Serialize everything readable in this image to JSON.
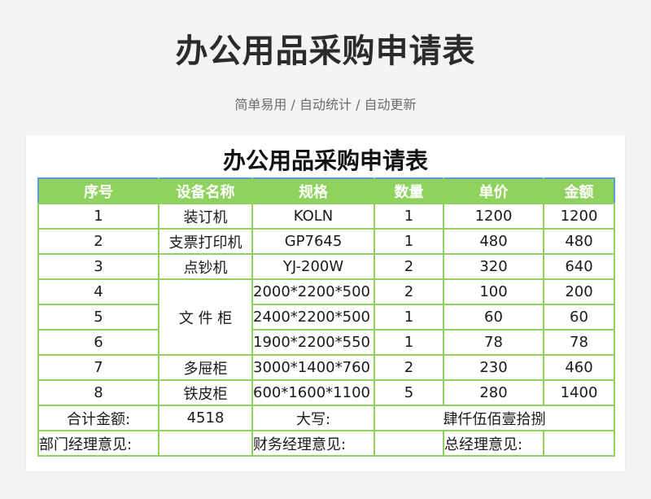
{
  "header": {
    "title": "办公用品采购申请表",
    "subtitle": "简单易用 / 自动统计 / 自动更新"
  },
  "sheet": {
    "title": "办公用品采购申请表",
    "columns": [
      "序号",
      "设备名称",
      "规格",
      "数量",
      "单价",
      "金额"
    ],
    "rows": [
      {
        "no": "1",
        "name": "装订机",
        "spec": "KOLN",
        "qty": "1",
        "price": "1200",
        "amount": "1200"
      },
      {
        "no": "2",
        "name": "支票打印机",
        "spec": "GP7645",
        "qty": "1",
        "price": "480",
        "amount": "480"
      },
      {
        "no": "3",
        "name": "点钞机",
        "spec": "YJ-200W",
        "qty": "2",
        "price": "320",
        "amount": "640"
      },
      {
        "no": "4",
        "name": "文 件 柜",
        "spec": "2000*2200*500",
        "qty": "2",
        "price": "100",
        "amount": "200"
      },
      {
        "no": "5",
        "name": "",
        "spec": "2400*2200*500",
        "qty": "1",
        "price": "60",
        "amount": "60"
      },
      {
        "no": "6",
        "name": "",
        "spec": "1900*2200*550",
        "qty": "1",
        "price": "78",
        "amount": "78"
      },
      {
        "no": "7",
        "name": "多屉柜",
        "spec": "3000*1400*760",
        "qty": "2",
        "price": "230",
        "amount": "460"
      },
      {
        "no": "8",
        "name": "铁皮柜",
        "spec": "600*1600*1100",
        "qty": "5",
        "price": "280",
        "amount": "1400"
      }
    ],
    "total": {
      "label": "合计金额:",
      "value": "4518",
      "capital_label": "大写:",
      "capital_value": "肆仟伍佰壹拾捌"
    },
    "approvals": {
      "dept": "部门经理意见:",
      "finance": "财务经理意见:",
      "general": "总经理意见:"
    }
  }
}
